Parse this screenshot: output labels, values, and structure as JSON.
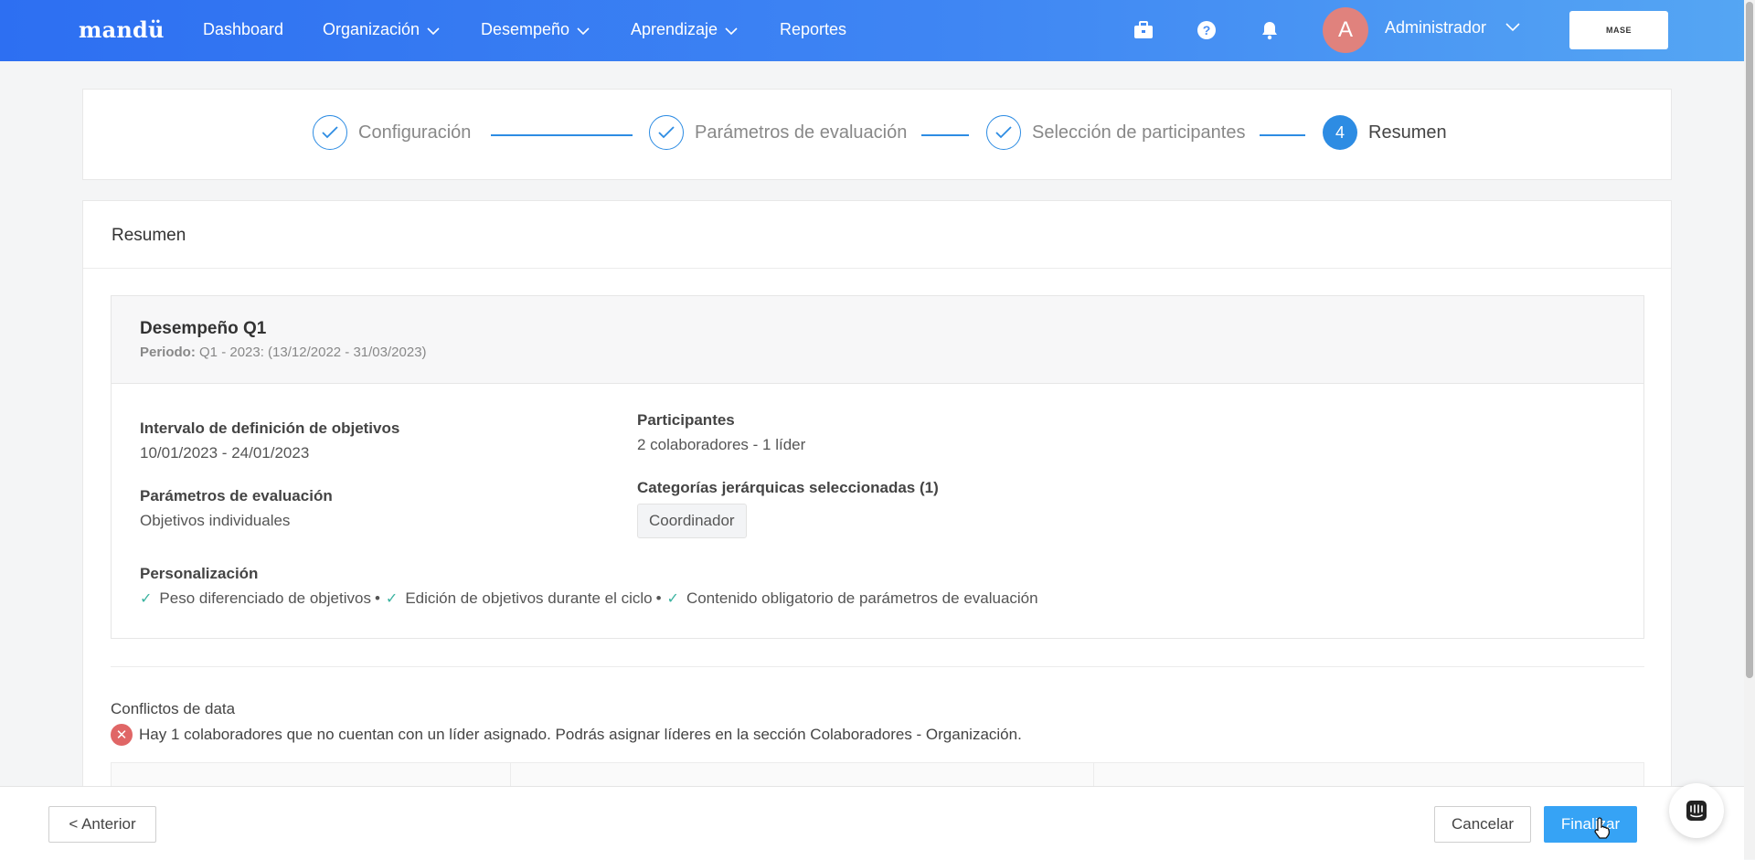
{
  "nav": {
    "brand": "mandü",
    "items": [
      {
        "label": "Dashboard"
      },
      {
        "label": "Organización"
      },
      {
        "label": "Desempeño"
      },
      {
        "label": "Aprendizaje"
      },
      {
        "label": "Reportes"
      }
    ],
    "user": {
      "initial": "A",
      "name": "Administrador"
    },
    "company_logo_text": "MASE",
    "icons": [
      "briefcase-icon",
      "help-icon",
      "bell-icon"
    ]
  },
  "stepper": {
    "steps": [
      {
        "label": "Configuración",
        "state": "done"
      },
      {
        "label": "Parámetros de evaluación",
        "state": "done"
      },
      {
        "label": "Selección de participantes",
        "state": "done"
      },
      {
        "label": "Resumen",
        "state": "active",
        "number": "4"
      }
    ]
  },
  "summary": {
    "title": "Resumen",
    "evaluation_name": "Desempeño Q1",
    "period_label": "Periodo:",
    "period_value": "Q1 - 2023: (13/12/2022 - 31/03/2023)",
    "objectives_interval_label": "Intervalo de definición de objetivos",
    "objectives_interval_value": "10/01/2023 - 24/01/2023",
    "eval_params_label": "Parámetros de evaluación",
    "eval_params_value": "Objetivos individuales",
    "participants_label": "Participantes",
    "participants_value": "2 colaboradores - 1 líder",
    "categories_label": "Categorías jerárquicas seleccionadas (1)",
    "categories": [
      "Coordinador"
    ],
    "customization_label": "Personalización",
    "customization_items": [
      "Peso diferenciado de objetivos",
      "Edición de objetivos durante el ciclo",
      "Contenido obligatorio de parámetros de evaluación"
    ],
    "separator": "•"
  },
  "conflicts": {
    "title": "Conflictos de data",
    "message": "Hay 1 colaboradores que no cuentan con un líder asignado. Podrás asignar líderes en la sección Colaboradores - Organización."
  },
  "footer": {
    "previous_label": "< Anterior",
    "cancel_label": "Cancelar",
    "finish_label": "Finalizar"
  },
  "colors": {
    "accent": "#2d8ce3",
    "primary_button": "#36a3f5",
    "error": "#e06666",
    "check": "#3bb3a0"
  }
}
